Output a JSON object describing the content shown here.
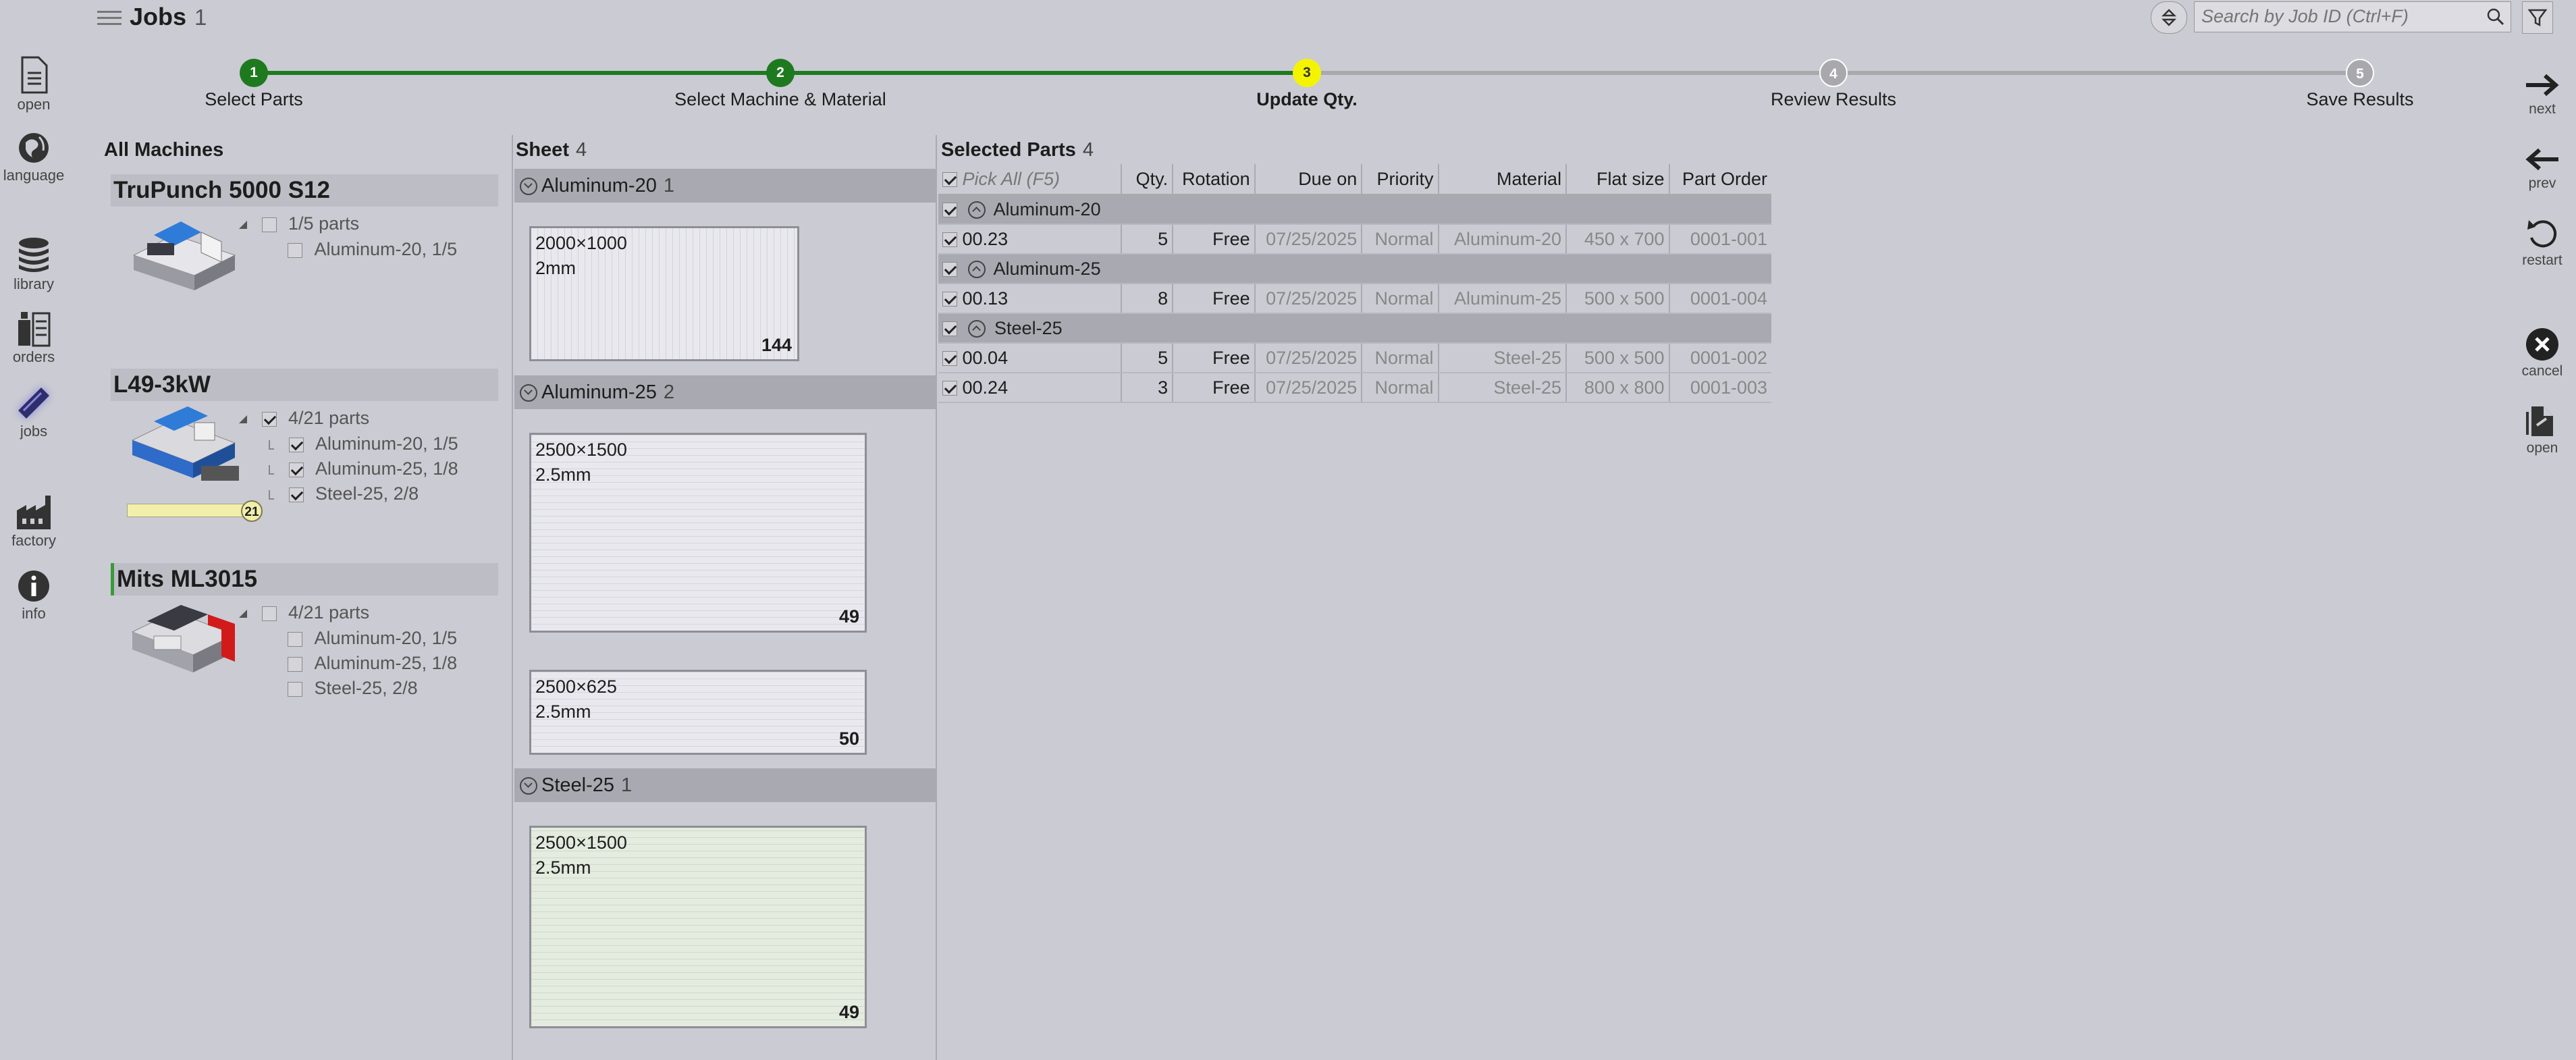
{
  "header": {
    "title": "Jobs",
    "count": "1",
    "search_placeholder": "Search by Job ID (Ctrl+F)"
  },
  "left_nav": [
    {
      "label": "open",
      "icon": "document-icon"
    },
    {
      "label": "language",
      "icon": "globe-icon"
    },
    {
      "label": "library",
      "icon": "coins-stack-icon"
    },
    {
      "label": "orders",
      "icon": "orders-icon"
    },
    {
      "label": "jobs",
      "icon": "jobs-icon",
      "active": true
    },
    {
      "label": "factory",
      "icon": "factory-icon"
    },
    {
      "label": "info",
      "icon": "info-icon"
    }
  ],
  "right_nav": [
    {
      "label": "next",
      "icon": "arrow-right-icon"
    },
    {
      "label": "prev",
      "icon": "arrow-left-icon"
    },
    {
      "label": "restart",
      "icon": "restart-icon"
    },
    {
      "label": "cancel",
      "icon": "close-icon"
    },
    {
      "label": "open",
      "icon": "open-file-icon"
    }
  ],
  "stepper": [
    {
      "num": "1",
      "label": "Select Parts",
      "state": "done"
    },
    {
      "num": "2",
      "label": "Select Machine & Material",
      "state": "done"
    },
    {
      "num": "3",
      "label": "Update Qty.",
      "state": "current"
    },
    {
      "num": "4",
      "label": "Review Results",
      "state": "todo"
    },
    {
      "num": "5",
      "label": "Save Results",
      "state": "todo"
    }
  ],
  "colors": {
    "done": "#1e7a1e",
    "current": "#f4f400",
    "todo": "#a9a9ad"
  },
  "machines": {
    "heading": "All Machines",
    "items": [
      {
        "name": "TruPunch 5000 S12",
        "summary": "1/5 parts",
        "checked": false,
        "materials": [
          {
            "label": "Aluminum-20, 1/5",
            "checked": false
          }
        ]
      },
      {
        "name": "L49-3kW",
        "summary": "4/21 parts",
        "checked": true,
        "progress": "21",
        "materials": [
          {
            "label": "Aluminum-20, 1/5",
            "checked": true
          },
          {
            "label": "Aluminum-25, 1/8",
            "checked": true
          },
          {
            "label": "Steel-25, 2/8",
            "checked": true
          }
        ]
      },
      {
        "name": "Mits ML3015",
        "summary": "4/21 parts",
        "checked": false,
        "materials": [
          {
            "label": "Aluminum-20, 1/5",
            "checked": false
          },
          {
            "label": "Aluminum-25, 1/8",
            "checked": false
          },
          {
            "label": "Steel-25, 2/8",
            "checked": false
          }
        ]
      }
    ]
  },
  "sheets": {
    "heading": "Sheet",
    "count": "4",
    "groups": [
      {
        "name": "Aluminum-20",
        "count": "1",
        "sheets": [
          {
            "size": "2000×1000",
            "thickness": "2mm",
            "qty": "144"
          }
        ]
      },
      {
        "name": "Aluminum-25",
        "count": "2",
        "sheets": [
          {
            "size": "2500×1500",
            "thickness": "2.5mm",
            "qty": "49"
          },
          {
            "size": "2500×625",
            "thickness": "2.5mm",
            "qty": "50"
          }
        ]
      },
      {
        "name": "Steel-25",
        "count": "1",
        "sheets": [
          {
            "size": "2500×1500",
            "thickness": "2.5mm",
            "qty": "49"
          }
        ]
      }
    ]
  },
  "parts": {
    "heading": "Selected Parts",
    "count": "4",
    "columns": [
      "Pick All (F5)",
      "Qty.",
      "Rotation",
      "Due on",
      "Priority",
      "Material",
      "Flat size",
      "Part Order"
    ],
    "groups": [
      {
        "name": "Aluminum-20",
        "rows": [
          {
            "id": "00.23",
            "qty": "5",
            "rotation": "Free",
            "due": "07/25/2025",
            "priority": "Normal",
            "material": "Aluminum-20",
            "flat": "450 x 700",
            "order": "0001-001"
          }
        ]
      },
      {
        "name": "Aluminum-25",
        "rows": [
          {
            "id": "00.13",
            "qty": "8",
            "rotation": "Free",
            "due": "07/25/2025",
            "priority": "Normal",
            "material": "Aluminum-25",
            "flat": "500 x 500",
            "order": "0001-004"
          }
        ]
      },
      {
        "name": "Steel-25",
        "rows": [
          {
            "id": "00.04",
            "qty": "5",
            "rotation": "Free",
            "due": "07/25/2025",
            "priority": "Normal",
            "material": "Steel-25",
            "flat": "500 x 500",
            "order": "0001-002"
          },
          {
            "id": "00.24",
            "qty": "3",
            "rotation": "Free",
            "due": "07/25/2025",
            "priority": "Normal",
            "material": "Steel-25",
            "flat": "800 x 800",
            "order": "0001-003"
          }
        ]
      }
    ]
  }
}
